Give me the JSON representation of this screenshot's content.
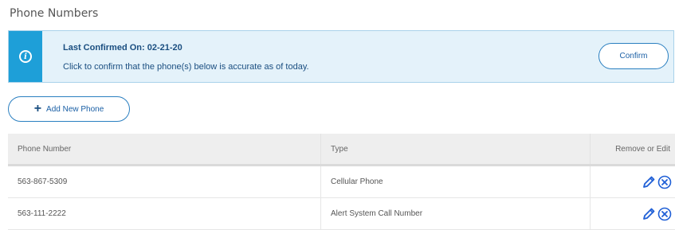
{
  "page_title": "Phone Numbers",
  "banner": {
    "icon": "info-icon",
    "title": "Last Confirmed On: 02-21-20",
    "message": "Click to confirm that the phone(s) below is accurate as of today.",
    "confirm_label": "Confirm"
  },
  "add_button": {
    "icon": "plus-icon",
    "label": "Add New Phone"
  },
  "table": {
    "headers": {
      "number": "Phone Number",
      "type": "Type",
      "actions": "Remove or Edit"
    },
    "rows": [
      {
        "number": "563-867-5309",
        "type": "Cellular Phone"
      },
      {
        "number": "563-111-2222",
        "type": "Alert System Call Number"
      }
    ]
  },
  "colors": {
    "accent": "#1e9fd8",
    "banner_bg": "#e4f2fa",
    "link_blue": "#1a5fa5",
    "icon_blue": "#1f5fd6"
  }
}
